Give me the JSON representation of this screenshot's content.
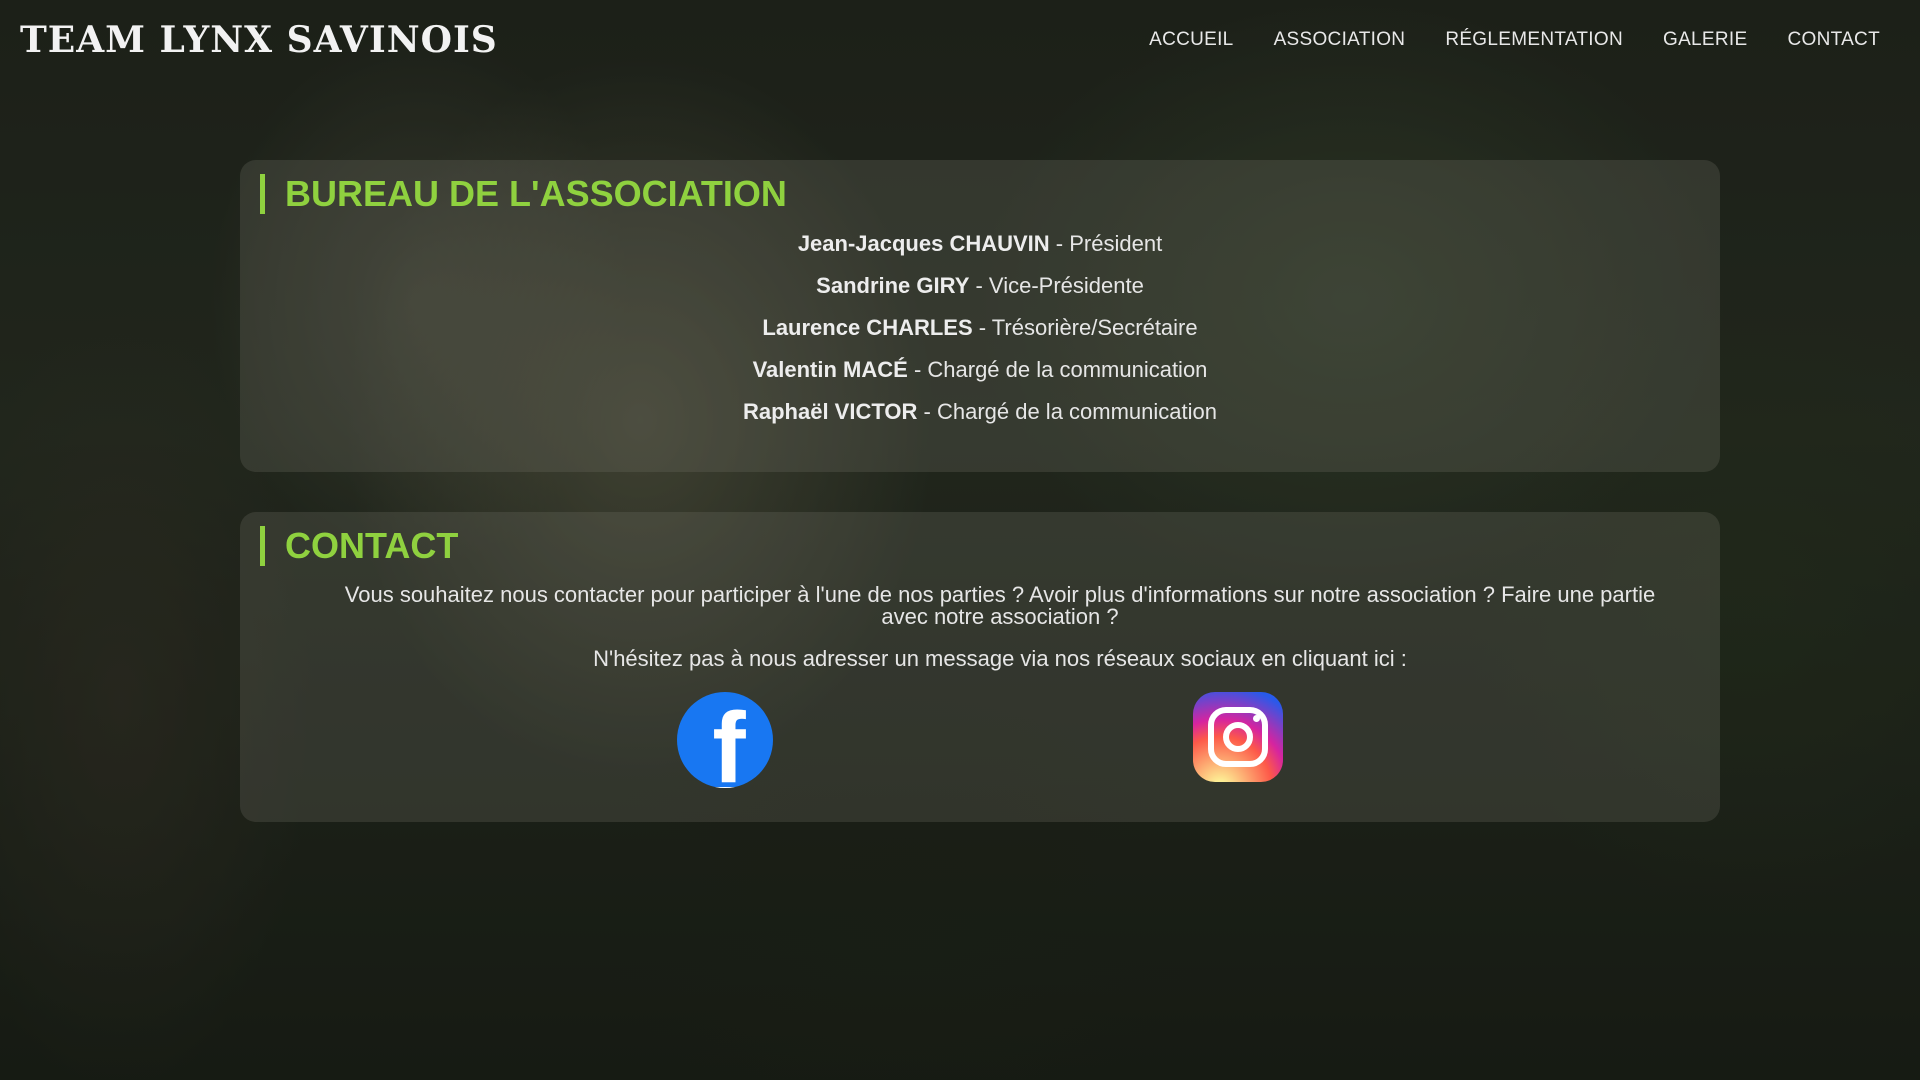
{
  "header": {
    "logo": "TEAM LYNX SAVINOIS",
    "nav": [
      "ACCUEIL",
      "ASSOCIATION",
      "RÉGLEMENTATION",
      "GALERIE",
      "CONTACT"
    ]
  },
  "bureau": {
    "title": "BUREAU DE L'ASSOCIATION",
    "members": [
      {
        "name": "Jean-Jacques CHAUVIN",
        "role": " - Président"
      },
      {
        "name": "Sandrine GIRY",
        "role": " - Vice-Présidente"
      },
      {
        "name": "Laurence CHARLES",
        "role": " - Trésorière/Secrétaire"
      },
      {
        "name": "Valentin MACÉ",
        "role": " - Chargé de la communication"
      },
      {
        "name": "Raphaël VICTOR",
        "role": " - Chargé de la communication"
      }
    ]
  },
  "contact": {
    "title": "CONTACT",
    "paragraph1": "Vous souhaitez nous contacter pour participer à l'une de nos parties ? Avoir plus d'informations sur notre association ? Faire une partie avec notre association ?",
    "paragraph2": "N'hésitez pas à nous adresser un message via nos réseaux sociaux en cliquant ici :",
    "facebook_glyph": "f"
  },
  "colors": {
    "accent": "#8fd13f",
    "facebook": "#1877f2"
  },
  "icons": [
    "facebook-icon",
    "instagram-icon"
  ]
}
